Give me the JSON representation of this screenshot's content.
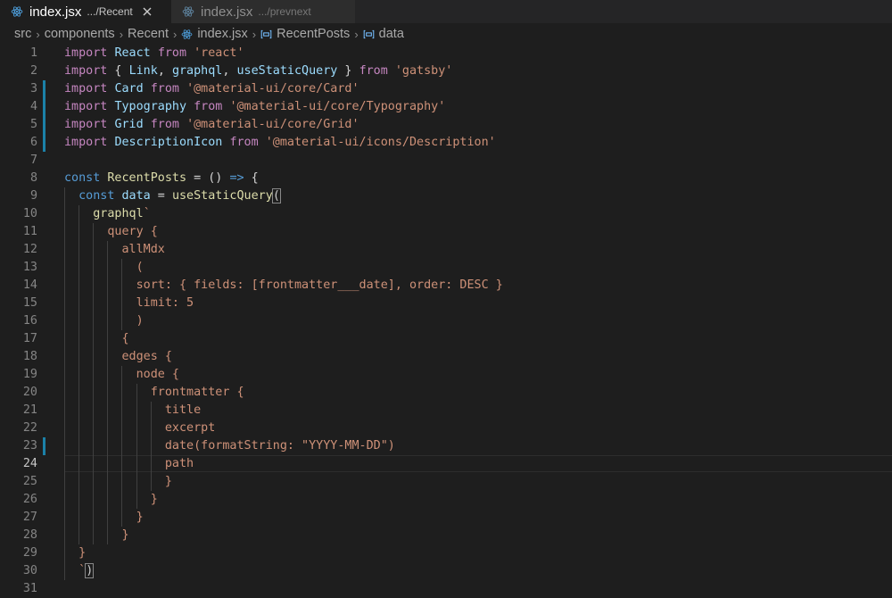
{
  "tabs": [
    {
      "name": "index.jsx",
      "path": ".../Recent",
      "active": true
    },
    {
      "name": "index.jsx",
      "path": ".../prevnext",
      "active": false
    }
  ],
  "breadcrumb": {
    "items": [
      "src",
      "components",
      "Recent",
      "index.jsx",
      "RecentPosts",
      "data"
    ]
  },
  "colors": {
    "keyword": "#c586c0",
    "storage": "#569cd6",
    "variable": "#9cdcfe",
    "function": "#dcdcaa",
    "string": "#ce9178",
    "plain": "#d4d4d4",
    "line_number": "#858585",
    "git_modified": "#1b81a8",
    "background": "#1e1e1e"
  },
  "editor": {
    "line_numbers": [
      "1",
      "2",
      "3",
      "4",
      "5",
      "6",
      "7",
      "8",
      "9",
      "10",
      "11",
      "12",
      "13",
      "14",
      "15",
      "16",
      "17",
      "18",
      "19",
      "20",
      "21",
      "22",
      "23",
      "24",
      "25",
      "26",
      "27",
      "28",
      "29",
      "30",
      "31"
    ],
    "modified_lines": [
      3,
      4,
      5,
      6,
      23
    ],
    "current_line": 24,
    "lines": [
      {
        "t": [
          [
            "kw",
            "import"
          ],
          [
            "pl",
            " "
          ],
          [
            "id",
            "React"
          ],
          [
            "pl",
            " "
          ],
          [
            "kw",
            "from"
          ],
          [
            "pl",
            " "
          ],
          [
            "str",
            "'react'"
          ]
        ]
      },
      {
        "t": [
          [
            "kw",
            "import"
          ],
          [
            "pl",
            " { "
          ],
          [
            "id",
            "Link"
          ],
          [
            "pl",
            ", "
          ],
          [
            "id",
            "graphql"
          ],
          [
            "pl",
            ", "
          ],
          [
            "id",
            "useStaticQuery"
          ],
          [
            "pl",
            " } "
          ],
          [
            "kw",
            "from"
          ],
          [
            "pl",
            " "
          ],
          [
            "str",
            "'gatsby'"
          ]
        ]
      },
      {
        "t": [
          [
            "kw",
            "import"
          ],
          [
            "pl",
            " "
          ],
          [
            "id",
            "Card"
          ],
          [
            "pl",
            " "
          ],
          [
            "kw",
            "from"
          ],
          [
            "pl",
            " "
          ],
          [
            "str",
            "'@material-ui/core/Card'"
          ]
        ]
      },
      {
        "t": [
          [
            "kw",
            "import"
          ],
          [
            "pl",
            " "
          ],
          [
            "id",
            "Typography"
          ],
          [
            "pl",
            " "
          ],
          [
            "kw",
            "from"
          ],
          [
            "pl",
            " "
          ],
          [
            "str",
            "'@material-ui/core/Typography'"
          ]
        ]
      },
      {
        "t": [
          [
            "kw",
            "import"
          ],
          [
            "pl",
            " "
          ],
          [
            "id",
            "Grid"
          ],
          [
            "pl",
            " "
          ],
          [
            "kw",
            "from"
          ],
          [
            "pl",
            " "
          ],
          [
            "str",
            "'@material-ui/core/Grid'"
          ]
        ]
      },
      {
        "t": [
          [
            "kw",
            "import"
          ],
          [
            "pl",
            " "
          ],
          [
            "id",
            "DescriptionIcon"
          ],
          [
            "pl",
            " "
          ],
          [
            "kw",
            "from"
          ],
          [
            "pl",
            " "
          ],
          [
            "str",
            "'@material-ui/icons/Description'"
          ]
        ]
      },
      {
        "t": []
      },
      {
        "t": [
          [
            "kw2",
            "const"
          ],
          [
            "pl",
            " "
          ],
          [
            "fn",
            "RecentPosts"
          ],
          [
            "pl",
            " = () "
          ],
          [
            "kw2",
            "=>"
          ],
          [
            "pl",
            " {"
          ]
        ]
      },
      {
        "t": [
          [
            "pl",
            "  "
          ],
          [
            "kw2",
            "const"
          ],
          [
            "pl",
            " "
          ],
          [
            "id",
            "data"
          ],
          [
            "pl",
            " = "
          ],
          [
            "fn",
            "useStaticQuery"
          ],
          [
            "bm",
            "("
          ]
        ]
      },
      {
        "t": [
          [
            "pl",
            "    "
          ],
          [
            "fn",
            "graphql"
          ],
          [
            "gq",
            "`"
          ]
        ]
      },
      {
        "t": [
          [
            "gq",
            "      query {"
          ]
        ]
      },
      {
        "t": [
          [
            "gq",
            "        allMdx"
          ]
        ]
      },
      {
        "t": [
          [
            "gq",
            "          ("
          ]
        ]
      },
      {
        "t": [
          [
            "gq",
            "          sort: { fields: [frontmatter___date], order: DESC }"
          ]
        ]
      },
      {
        "t": [
          [
            "gq",
            "          limit: 5"
          ]
        ]
      },
      {
        "t": [
          [
            "gq",
            "          )"
          ]
        ]
      },
      {
        "t": [
          [
            "gq",
            "        {"
          ]
        ]
      },
      {
        "t": [
          [
            "gq",
            "        edges {"
          ]
        ]
      },
      {
        "t": [
          [
            "gq",
            "          node {"
          ]
        ]
      },
      {
        "t": [
          [
            "gq",
            "            frontmatter {"
          ]
        ]
      },
      {
        "t": [
          [
            "gq",
            "              title"
          ]
        ]
      },
      {
        "t": [
          [
            "gq",
            "              excerpt"
          ]
        ]
      },
      {
        "t": [
          [
            "gq",
            "              date(formatString: \"YYYY-MM-DD\")"
          ]
        ]
      },
      {
        "t": [
          [
            "gq",
            "              path"
          ]
        ]
      },
      {
        "t": [
          [
            "gq",
            "              }"
          ]
        ]
      },
      {
        "t": [
          [
            "gq",
            "            }"
          ]
        ]
      },
      {
        "t": [
          [
            "gq",
            "          }"
          ]
        ]
      },
      {
        "t": [
          [
            "gq",
            "        }"
          ]
        ]
      },
      {
        "t": [
          [
            "gq",
            "  }"
          ]
        ]
      },
      {
        "t": [
          [
            "gq",
            "  `"
          ],
          [
            "bm",
            ")"
          ]
        ]
      },
      {
        "t": []
      }
    ]
  }
}
